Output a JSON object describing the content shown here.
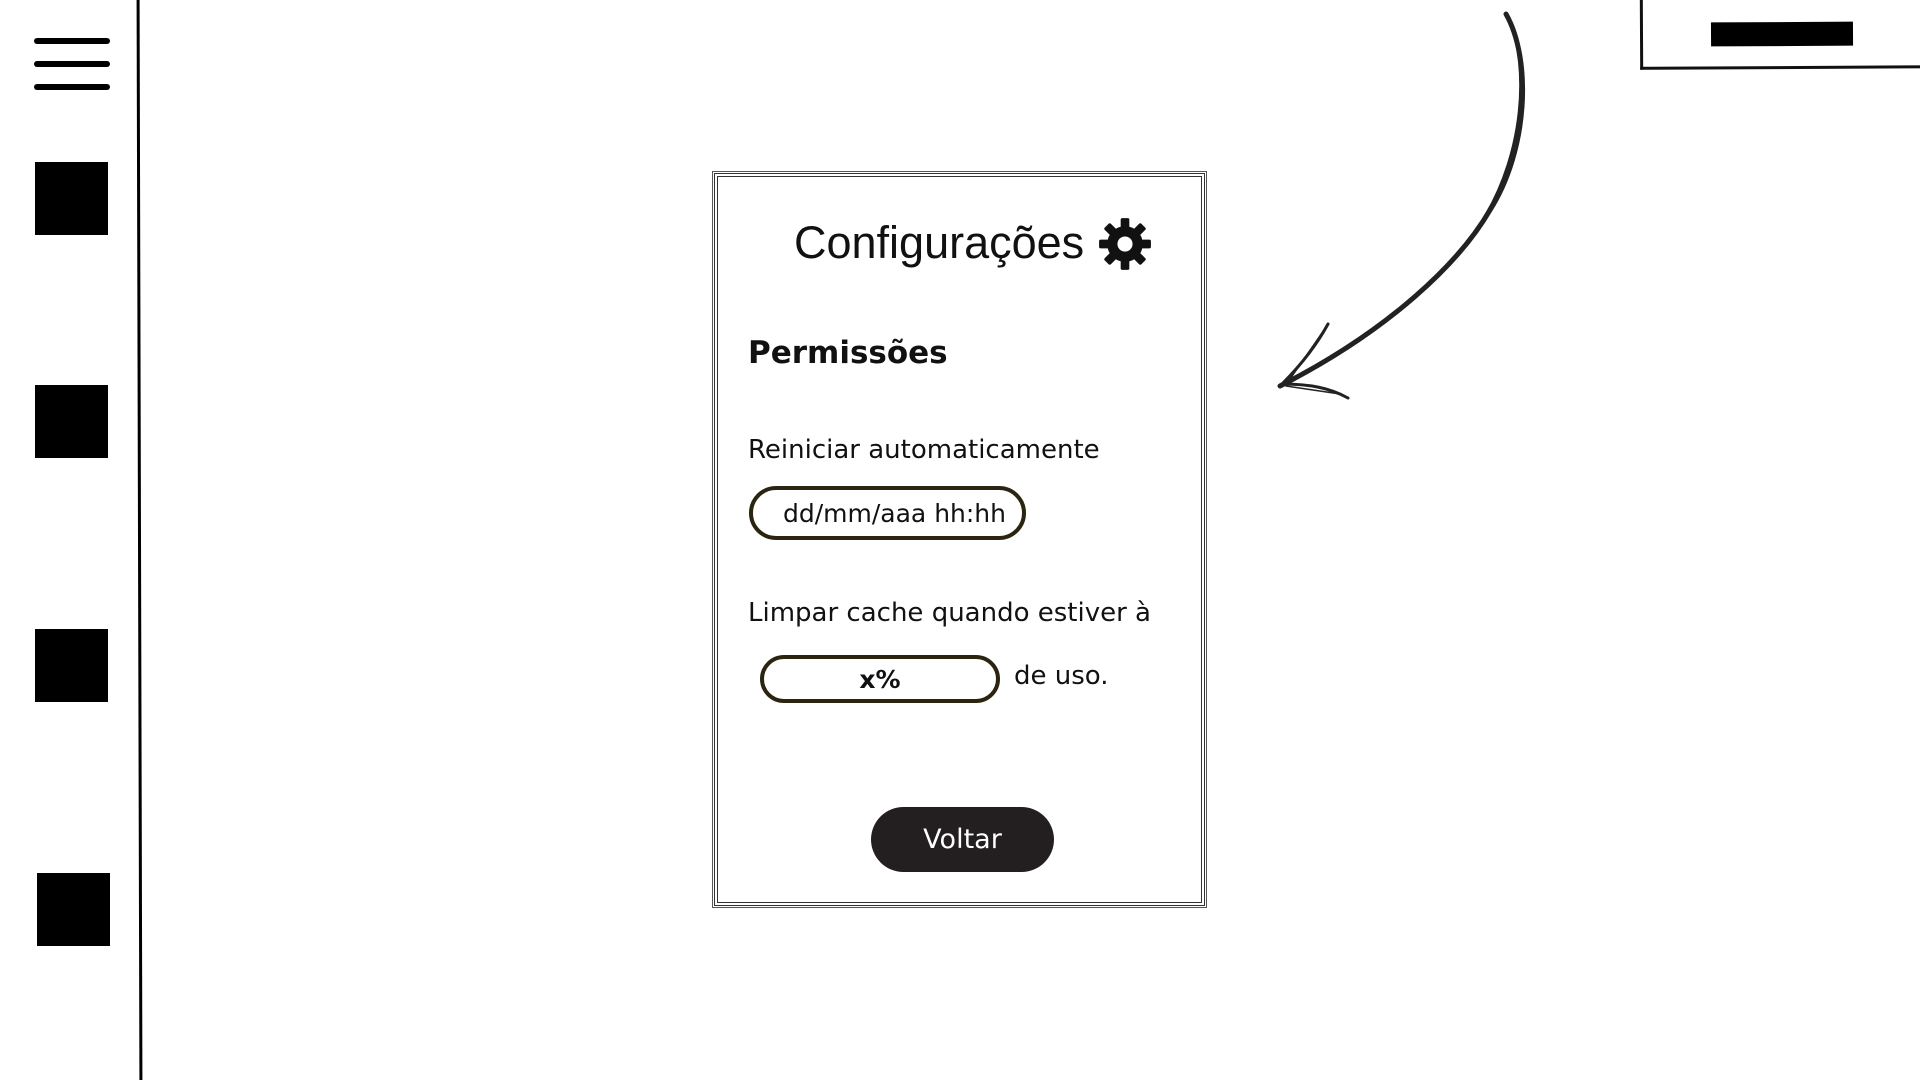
{
  "settings_card": {
    "title": "Configurações",
    "title_icon": "gear-icon",
    "section_heading": "Permissões",
    "auto_restart": {
      "label": "Reiniciar automaticamente",
      "placeholder": "dd/mm/aaa hh:hh"
    },
    "clear_cache": {
      "label": "Limpar cache quando estiver à",
      "placeholder": "x%",
      "suffix": "de uso."
    },
    "back_button_label": "Voltar"
  },
  "sidebar": {
    "menu_icon": "hamburger-menu-icon",
    "items": [
      "block",
      "block",
      "block",
      "block"
    ]
  },
  "colors": {
    "button_background": "#231f20",
    "input_border": "#2a2410",
    "ink": "#000000"
  }
}
